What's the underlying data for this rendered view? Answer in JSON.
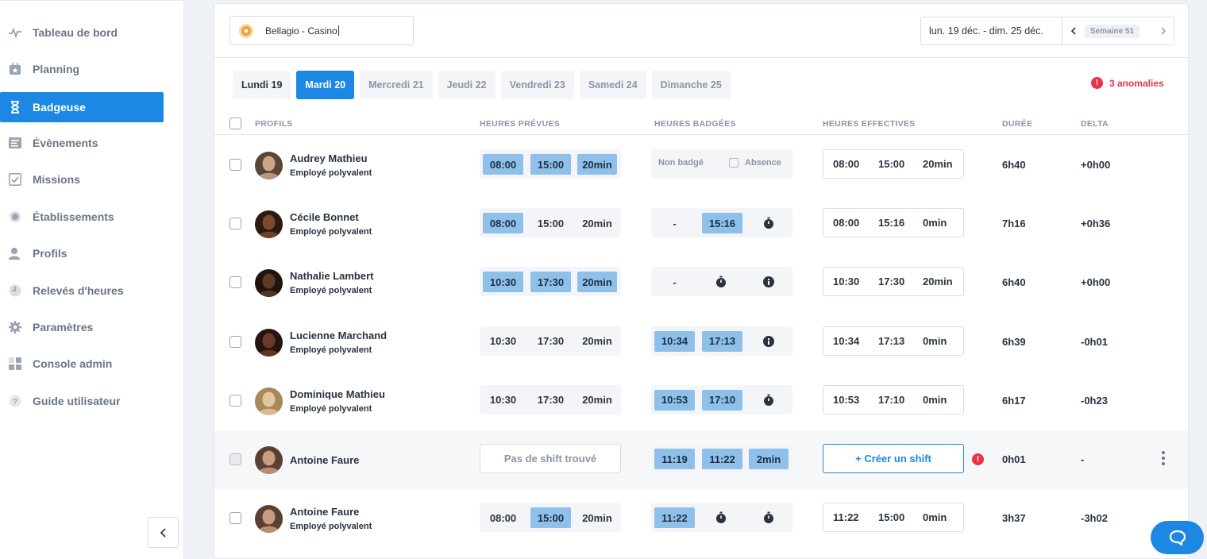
{
  "sidebar": {
    "items": [
      {
        "label": "Tableau de bord",
        "icon": "pulse-icon"
      },
      {
        "label": "Planning",
        "icon": "calendar-icon"
      },
      {
        "label": "Badgeuse",
        "icon": "hourglass-icon",
        "active": true
      },
      {
        "label": "Évènements",
        "icon": "list-icon"
      },
      {
        "label": "Missions",
        "icon": "checklist-icon"
      },
      {
        "label": "Établissements",
        "icon": "location-icon"
      },
      {
        "label": "Profils",
        "icon": "user-icon"
      },
      {
        "label": "Relevés d'heures",
        "icon": "clock-icon"
      },
      {
        "label": "Paramètres",
        "icon": "gear-icon"
      },
      {
        "label": "Console admin",
        "icon": "grid-icon"
      },
      {
        "label": "Guide utilisateur",
        "icon": "help-icon"
      }
    ]
  },
  "toolbar": {
    "site": "Bellagio - Casino",
    "week_range": "lun. 19 déc. - dim. 25 déc.",
    "week_label": "Semaine 51"
  },
  "days": [
    {
      "label": "Lundi 19"
    },
    {
      "label": "Mardi 20",
      "active": true
    },
    {
      "label": "Mercredi 21"
    },
    {
      "label": "Jeudi 22"
    },
    {
      "label": "Vendredi 23"
    },
    {
      "label": "Samedi 24"
    },
    {
      "label": "Dimanche 25"
    }
  ],
  "anomalies": {
    "icon": "!",
    "label": "3 anomalies"
  },
  "table": {
    "headers": {
      "profils": "PROFILS",
      "prevues": "HEURES PRÉVUES",
      "badgees": "HEURES BADGÉES",
      "effectives": "HEURES EFFECTIVES",
      "duree": "DURÉE",
      "delta": "DELTA"
    },
    "rows": [
      {
        "name": "Audrey Mathieu",
        "role": "Employé polyvalent",
        "planned": [
          "08:00",
          "15:00",
          "20min"
        ],
        "planned_hl": [
          true,
          true,
          true
        ],
        "badged_type": "nonbadge",
        "nonbadge_label": "Non badgé",
        "absence_label": "Absence",
        "effective": [
          "08:00",
          "15:00",
          "20min"
        ],
        "duree": "6h40",
        "delta": "+0h00"
      },
      {
        "name": "Cécile Bonnet",
        "role": "Employé polyvalent",
        "planned": [
          "08:00",
          "15:00",
          "20min"
        ],
        "planned_hl": [
          true,
          false,
          false
        ],
        "badged_type": "dash_time_timer",
        "badged": [
          "-",
          "15:16"
        ],
        "effective": [
          "08:00",
          "15:16",
          "0min"
        ],
        "duree": "7h16",
        "delta": "+0h36"
      },
      {
        "name": "Nathalie Lambert",
        "role": "Employé polyvalent",
        "planned": [
          "10:30",
          "17:30",
          "20min"
        ],
        "planned_hl": [
          true,
          true,
          true
        ],
        "badged_type": "dash_timer_info",
        "badged": [
          "-"
        ],
        "effective": [
          "10:30",
          "17:30",
          "20min"
        ],
        "duree": "6h40",
        "delta": "+0h00"
      },
      {
        "name": "Lucienne Marchand",
        "role": "Employé polyvalent",
        "planned": [
          "10:30",
          "17:30",
          "20min"
        ],
        "planned_hl": [
          false,
          false,
          false
        ],
        "badged_type": "two_info",
        "badged": [
          "10:34",
          "17:13"
        ],
        "effective": [
          "10:34",
          "17:13",
          "0min"
        ],
        "duree": "6h39",
        "delta": "-0h01"
      },
      {
        "name": "Dominique Mathieu",
        "role": "Employé polyvalent",
        "planned": [
          "10:30",
          "17:30",
          "20min"
        ],
        "planned_hl": [
          false,
          false,
          false
        ],
        "badged_type": "two_timer",
        "badged": [
          "10:53",
          "17:10"
        ],
        "effective": [
          "10:53",
          "17:10",
          "0min"
        ],
        "duree": "6h17",
        "delta": "-0h23"
      },
      {
        "name": "Antoine Faure",
        "role": "",
        "no_shift": "Pas de shift trouvé",
        "badged_type": "three",
        "badged": [
          "11:19",
          "11:22",
          "2min"
        ],
        "create_shift": "+ Créer un shift",
        "error_icon": "!",
        "duree": "0h01",
        "delta": "-"
      },
      {
        "name": "Antoine Faure",
        "role": "Employé polyvalent",
        "planned": [
          "08:00",
          "15:00",
          "20min"
        ],
        "planned_hl": [
          false,
          true,
          false
        ],
        "badged_type": "one_two_timers",
        "badged": [
          "11:22"
        ],
        "effective": [
          "11:22",
          "15:00",
          "0min"
        ],
        "duree": "3h37",
        "delta": "-3h02"
      }
    ]
  },
  "colors": {
    "accent": "#1d87e4",
    "chip": "#8fc0ea",
    "error": "#e8334a"
  }
}
